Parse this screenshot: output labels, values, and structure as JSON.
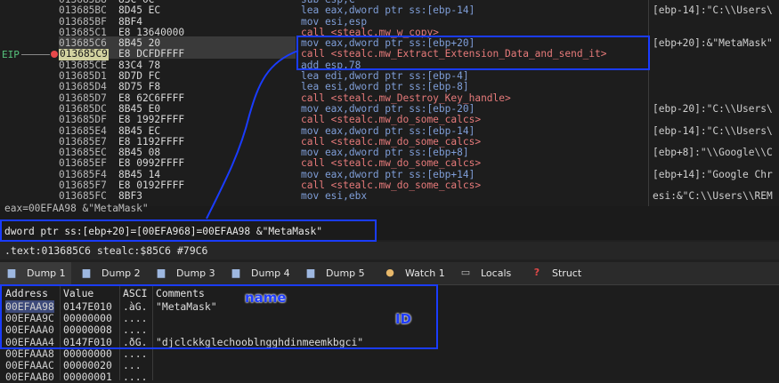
{
  "disasm": {
    "eip_label": "EIP",
    "rows": [
      {
        "addr": "013685B8",
        "bytes": "83C 0C",
        "instr": "sub esp,C",
        "type": "normal",
        "cmt": ""
      },
      {
        "addr": "013685BC",
        "bytes": "8D45 EC",
        "instr": "lea eax,dword ptr ss:[ebp-14]",
        "type": "normal",
        "cmt": "[ebp-14]:\"C:\\\\Users\\"
      },
      {
        "addr": "013685BF",
        "bytes": "8BF4",
        "instr": "mov esi,esp",
        "type": "normal",
        "cmt": ""
      },
      {
        "addr": "013685C1",
        "bytes": "E8 13640000",
        "instr": "call <stealc.mw_w_copy>",
        "type": "call",
        "cmt": ""
      },
      {
        "addr": "013685C6",
        "bytes": "8B45 20",
        "instr": "mov eax,dword ptr ss:[ebp+20]",
        "type": "normal",
        "cmt": "[ebp+20]:&\"MetaMask\""
      },
      {
        "addr": "013685C9",
        "bytes": "E8 DCFDFFFF",
        "instr": "call <stealc.mw_Extract_Extension_Data_and_send_it>",
        "type": "call",
        "cmt": "",
        "eip": true
      },
      {
        "addr": "013685CE",
        "bytes": "83C4 78",
        "instr": "add esp,78",
        "type": "normal",
        "cmt": ""
      },
      {
        "addr": "013685D1",
        "bytes": "8D7D FC",
        "instr": "lea edi,dword ptr ss:[ebp-4]",
        "type": "normal",
        "cmt": ""
      },
      {
        "addr": "013685D4",
        "bytes": "8D75 F8",
        "instr": "lea esi,dword ptr ss:[ebp-8]",
        "type": "normal",
        "cmt": ""
      },
      {
        "addr": "013685D7",
        "bytes": "E8 62C6FFFF",
        "instr": "call <stealc.mw_Destroy_Key_handle>",
        "type": "call",
        "cmt": ""
      },
      {
        "addr": "013685DC",
        "bytes": "8B45 E0",
        "instr": "mov eax,dword ptr ss:[ebp-20]",
        "type": "normal",
        "cmt": "[ebp-20]:\"C:\\\\Users\\"
      },
      {
        "addr": "013685DF",
        "bytes": "E8 1992FFFF",
        "instr": "call <stealc.mw_do_some_calcs>",
        "type": "call",
        "cmt": ""
      },
      {
        "addr": "013685E4",
        "bytes": "8B45 EC",
        "instr": "mov eax,dword ptr ss:[ebp-14]",
        "type": "normal",
        "cmt": "[ebp-14]:\"C:\\\\Users\\"
      },
      {
        "addr": "013685E7",
        "bytes": "E8 1192FFFF",
        "instr": "call <stealc.mw_do_some_calcs>",
        "type": "call",
        "cmt": ""
      },
      {
        "addr": "013685EC",
        "bytes": "8B45 08",
        "instr": "mov eax,dword ptr ss:[ebp+8]",
        "type": "normal",
        "cmt": "[ebp+8]:\"\\\\Google\\\\C"
      },
      {
        "addr": "013685EF",
        "bytes": "E8 0992FFFF",
        "instr": "call <stealc.mw_do_some_calcs>",
        "type": "call",
        "cmt": ""
      },
      {
        "addr": "013685F4",
        "bytes": "8B45 14",
        "instr": "mov eax,dword ptr ss:[ebp+14]",
        "type": "normal",
        "cmt": "[ebp+14]:\"Google Chr"
      },
      {
        "addr": "013685F7",
        "bytes": "E8 0192FFFF",
        "instr": "call <stealc.mw_do_some_calcs>",
        "type": "call",
        "cmt": ""
      },
      {
        "addr": "013685FC",
        "bytes": "8BF3",
        "instr": "mov esi,ebx",
        "type": "normal",
        "cmt": "esi:&\"C:\\\\Users\\\\REM"
      }
    ]
  },
  "info": {
    "line1": "eax=00EFAA98 &\"MetaMask\"",
    "line2": "dword ptr ss:[ebp+20]=[00EFA968]=00EFAA98 &\"MetaMask\""
  },
  "status": {
    "text": ".text:013685C6 stealc:$85C6 #79C6"
  },
  "tabs": [
    {
      "label": "Dump 1",
      "icon": "dump-icon"
    },
    {
      "label": "Dump 2",
      "icon": "dump-icon"
    },
    {
      "label": "Dump 3",
      "icon": "dump-icon"
    },
    {
      "label": "Dump 4",
      "icon": "dump-icon"
    },
    {
      "label": "Dump 5",
      "icon": "dump-icon"
    },
    {
      "label": "Watch 1",
      "icon": "watch-icon"
    },
    {
      "label": "Locals",
      "icon": "locals-icon"
    },
    {
      "label": "Struct",
      "icon": "struct-icon"
    }
  ],
  "dump": {
    "headers": {
      "address": "Address",
      "value": "Value",
      "ascii": "ASCI",
      "comments": "Comments"
    },
    "rows": [
      {
        "address": "00EFAA98",
        "value": "0147E010",
        "ascii": ".àG.",
        "comment": "\"MetaMask\""
      },
      {
        "address": "00EFAA9C",
        "value": "00000000",
        "ascii": "....",
        "comment": ""
      },
      {
        "address": "00EFAAA0",
        "value": "00000008",
        "ascii": "....",
        "comment": ""
      },
      {
        "address": "00EFAAA4",
        "value": "0147F010",
        "ascii": ".ðG.",
        "comment": "\"djclckkglechooblngghdinmeemkbgci\""
      },
      {
        "address": "00EFAAA8",
        "value": "00000000",
        "ascii": "....",
        "comment": ""
      },
      {
        "address": "00EFAAAC",
        "value": "00000020",
        "ascii": " ...",
        "comment": ""
      },
      {
        "address": "00EFAAB0",
        "value": "00000001",
        "ascii": "....",
        "comment": ""
      }
    ]
  },
  "annotations": {
    "name_label": "name",
    "id_label": "ID",
    "color": "#1a3cff"
  }
}
